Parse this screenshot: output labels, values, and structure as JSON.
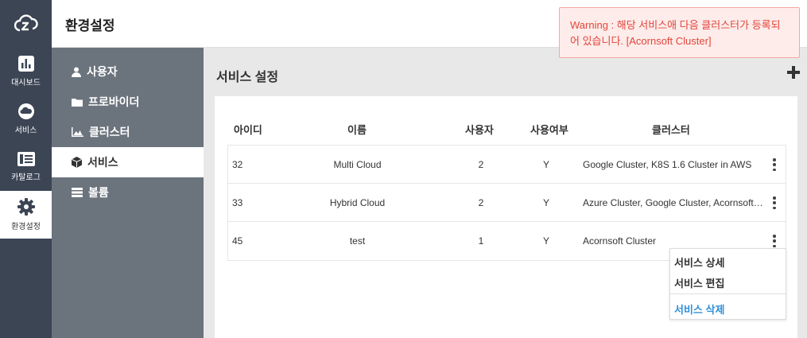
{
  "rail": {
    "logo_icon": "cloud-logo-icon",
    "items": [
      {
        "label": "대시보드",
        "icon": "bar-chart-icon"
      },
      {
        "label": "서비스",
        "icon": "cloud-icon"
      },
      {
        "label": "카탈로그",
        "icon": "catalog-icon"
      },
      {
        "label": "환경설정",
        "icon": "gear-icon"
      }
    ]
  },
  "header": {
    "title": "환경설정"
  },
  "subnav": {
    "items": [
      {
        "label": "사용자",
        "icon": "user-icon"
      },
      {
        "label": "프로바이더",
        "icon": "folder-icon"
      },
      {
        "label": "클러스터",
        "icon": "area-chart-icon"
      },
      {
        "label": "서비스",
        "icon": "cube-icon"
      },
      {
        "label": "볼륨",
        "icon": "server-icon"
      }
    ]
  },
  "main": {
    "title": "서비스 설정",
    "add_icon": "plus-icon",
    "table": {
      "headers": [
        "아이디",
        "이름",
        "사용자",
        "사용여부",
        "클러스터"
      ],
      "rows": [
        {
          "id": "32",
          "name": "Multi Cloud",
          "user": "2",
          "use": "Y",
          "cluster": "Google Cluster, K8S 1.6 Cluster in AWS"
        },
        {
          "id": "33",
          "name": "Hybrid Cloud",
          "user": "2",
          "use": "Y",
          "cluster": "Azure Cluster, Google Cluster, Acornsoft Cl..."
        },
        {
          "id": "45",
          "name": "test",
          "user": "1",
          "use": "Y",
          "cluster": "Acornsoft Cluster"
        }
      ]
    }
  },
  "context_menu": {
    "detail": "서비스 상세",
    "edit": "서비스 편집",
    "delete": "서비스 삭제"
  },
  "toast": {
    "text": "Warning : 해당 서비스애 다음 클러스터가 등록되어 있습니다. [Acornsoft Cluster]"
  },
  "colors": {
    "rail": "#3c4554",
    "subnav": "#6b737d",
    "warning": "#e2453b",
    "link": "#2f8fd8"
  }
}
